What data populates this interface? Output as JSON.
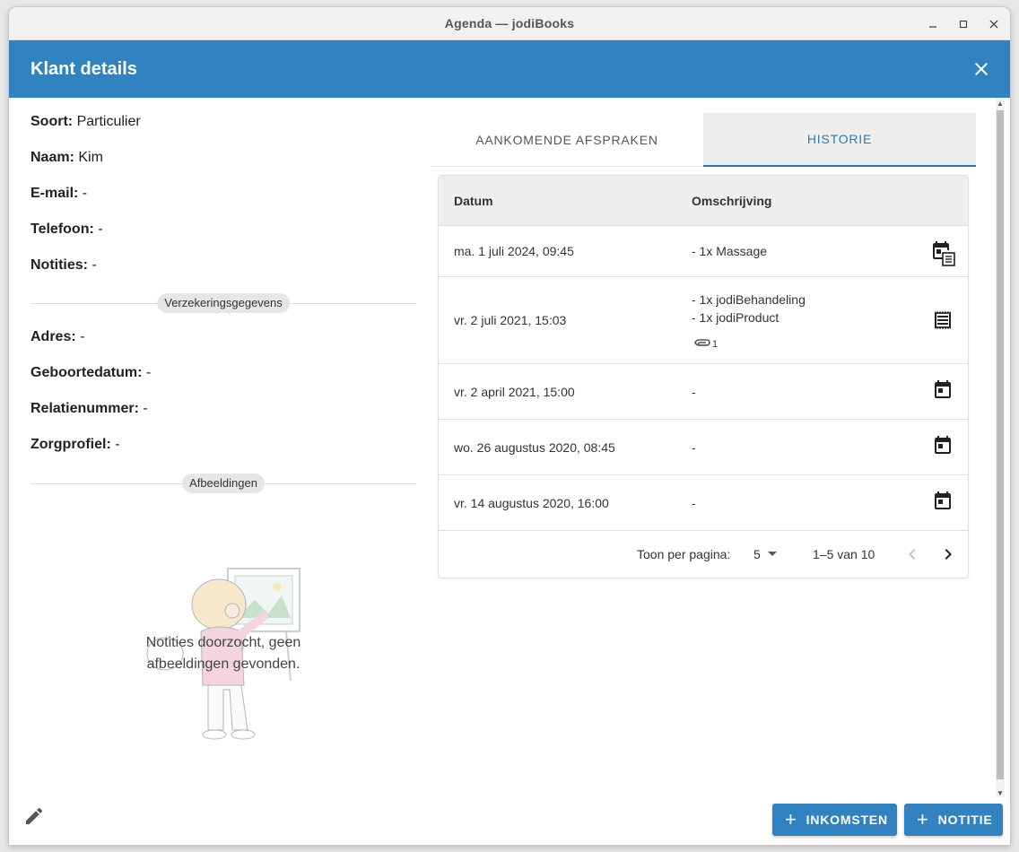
{
  "window": {
    "title": "Agenda — jodiBooks"
  },
  "header": {
    "title": "Klant details"
  },
  "client": {
    "fields": [
      {
        "label": "Soort:",
        "value": "Particulier"
      },
      {
        "label": "Naam:",
        "value": "Kim"
      },
      {
        "label": "E-mail:",
        "value": "-"
      },
      {
        "label": "Telefoon:",
        "value": "-"
      },
      {
        "label": "Notities:",
        "value": "-"
      }
    ],
    "insurance_divider": "Verzekeringsgegevens",
    "insurance_fields": [
      {
        "label": "Adres:",
        "value": "-"
      },
      {
        "label": "Geboortedatum:",
        "value": "-"
      },
      {
        "label": "Relatienummer:",
        "value": "-"
      },
      {
        "label": "Zorgprofiel:",
        "value": "-"
      }
    ],
    "images_divider": "Afbeeldingen",
    "images_empty": "Notities doorzocht, geen afbeeldingen gevonden."
  },
  "tabs": [
    {
      "label": "Aankomende afspraken",
      "active": false
    },
    {
      "label": "Historie",
      "active": true
    }
  ],
  "table": {
    "headers": [
      "Datum",
      "Omschrijving"
    ],
    "rows": [
      {
        "date": "ma. 1 juli 2024, 09:45",
        "desc": [
          "- 1x Massage"
        ],
        "attachments": "",
        "icon": "calendar-invoice-icon"
      },
      {
        "date": "vr. 2 juli 2021, 15:03",
        "desc": [
          "- 1x jodiBehandeling",
          "- 1x jodiProduct"
        ],
        "attachments": "1",
        "icon": "invoice-icon"
      },
      {
        "date": "vr. 2 april 2021, 15:00",
        "desc": [
          "-"
        ],
        "attachments": "",
        "icon": "calendar-icon"
      },
      {
        "date": "wo. 26 augustus 2020, 08:45",
        "desc": [
          "-"
        ],
        "attachments": "",
        "icon": "calendar-icon"
      },
      {
        "date": "vr. 14 augustus 2020, 16:00",
        "desc": [
          "-"
        ],
        "attachments": "",
        "icon": "calendar-icon"
      }
    ],
    "pager": {
      "label": "Toon per pagina:",
      "per_page": "5",
      "range": "1–5 van 10"
    }
  },
  "footer": {
    "income_button": "INKOMSTEN",
    "note_button": "NOTITIE"
  },
  "colors": {
    "primary": "#3083c0",
    "tab_active": "#2a7ab8"
  }
}
